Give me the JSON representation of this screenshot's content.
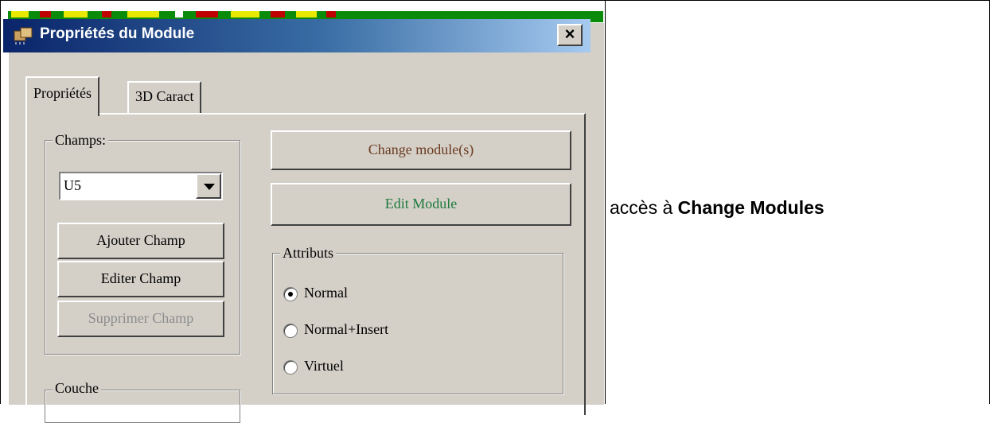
{
  "dialog": {
    "title": "Propriétés du Module",
    "close_label": "×",
    "tabs": [
      {
        "label": "Propriétés",
        "active": true
      },
      {
        "label": "3D Caract",
        "active": false
      }
    ]
  },
  "fields": {
    "group_label": "Champs:",
    "combo_value": "U5",
    "buttons": [
      {
        "label": "Ajouter Champ",
        "enabled": true
      },
      {
        "label": "Editer Champ",
        "enabled": true
      },
      {
        "label": "Supprimer Champ",
        "enabled": false
      }
    ]
  },
  "actions": {
    "change_module": "Change module(s)",
    "edit_module": "Edit Module",
    "change_color": "#6b3a1f",
    "edit_color": "#1e7a3c"
  },
  "attributes": {
    "group_label": "Attributs",
    "options": [
      {
        "label": "Normal",
        "checked": true
      },
      {
        "label": "Normal+Insert",
        "checked": false
      },
      {
        "label": "Virtuel",
        "checked": false
      }
    ]
  },
  "layer": {
    "group_label": "Couche"
  },
  "caption": {
    "prefix": "accès à ",
    "bold": "Change Modules"
  }
}
